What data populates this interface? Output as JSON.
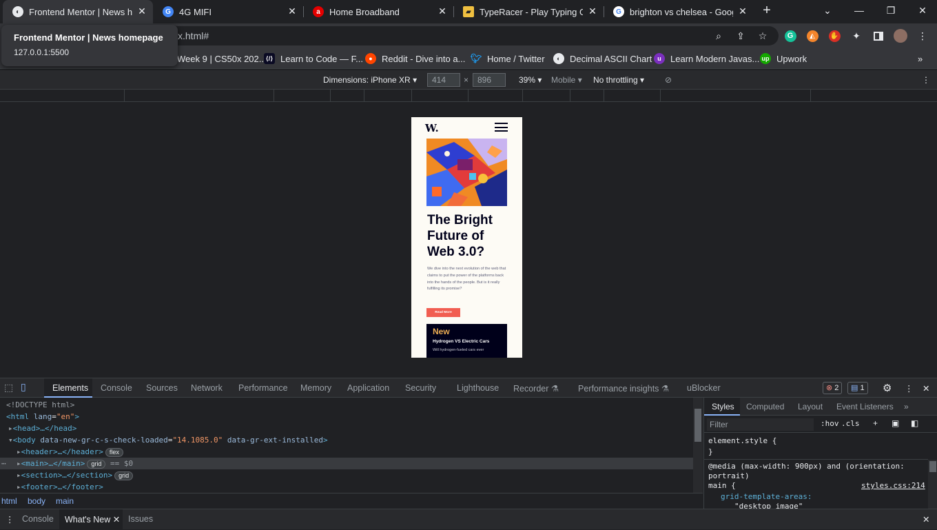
{
  "tabs": [
    {
      "title": "Frontend Mentor | News hom",
      "active": true
    },
    {
      "title": "4G MIFI"
    },
    {
      "title": "Home Broadband"
    },
    {
      "title": "TypeRacer - Play Typing Gam"
    },
    {
      "title": "brighton vs chelsea - Google"
    }
  ],
  "tooltip": {
    "title": "Frontend Mentor | News homepage",
    "url": "127.0.0.1:5500"
  },
  "omnibox": {
    "url": "x.html#"
  },
  "bookmarks": [
    {
      "label": "Week 9 | CS50x 202..."
    },
    {
      "label": "Learn to Code — F..."
    },
    {
      "label": "Reddit - Dive into a..."
    },
    {
      "label": "Home / Twitter"
    },
    {
      "label": "Decimal ASCII Chart"
    },
    {
      "label": "Learn Modern Javas..."
    },
    {
      "label": "Upwork"
    }
  ],
  "device_bar": {
    "dimensions": "Dimensions: iPhone XR",
    "width": "414",
    "x": "×",
    "height": "896",
    "zoom": "39%",
    "mode": "Mobile",
    "throttle": "No throttling"
  },
  "page": {
    "logo": "W.",
    "headline": "The Bright Future of Web 3.0?",
    "description": "We dive into the next evolution of the web that claims to put the power of the platforms back into the hands of the people. But is it really fulfilling its promise?",
    "read_more": "Read More",
    "new_heading": "New",
    "new_title": "Hydrogen VS Electric Cars",
    "new_desc": "Will hydrogen-fueled cars ever"
  },
  "devtools": {
    "tabs": [
      "Elements",
      "Console",
      "Sources",
      "Network",
      "Performance",
      "Memory",
      "Application",
      "Security",
      "Lighthouse",
      "Recorder",
      "Performance insights",
      "uBlocker"
    ],
    "errors": "2",
    "messages": "1",
    "dom": {
      "doctype": "<!DOCTYPE html>",
      "html_open": "<html",
      "lang_attr": "lang",
      "lang_val": "\"en\"",
      "head": "<head>…</head>",
      "body_open": "<body",
      "body_attr1": "data-new-gr-c-s-check-loaded",
      "body_val1": "\"14.1085.0\"",
      "body_attr2": "data-gr-ext-installed",
      "header": "<header>…</header>",
      "header_pill": "flex",
      "main": "<main>…</main>",
      "main_pill": "grid",
      "main_eq": "== $0",
      "section": "<section>…</section>",
      "section_pill": "grid",
      "footer": "<footer>…</footer>"
    },
    "breadcrumbs": [
      "html",
      "body",
      "main"
    ],
    "styles_tabs": [
      "Styles",
      "Computed",
      "Layout",
      "Event Listeners"
    ],
    "filter_placeholder": "Filter",
    "hov": ":hov",
    "cls": ".cls",
    "styles": {
      "element_style": "element.style {",
      "close": "}",
      "media": "@media (max-width: 900px) and (orientation:",
      "media2": "portrait)",
      "selector": "main {",
      "source": "styles.css:214",
      "prop": "grid-template-areas:",
      "val": "\"desktop  image\""
    },
    "drawer_tabs": [
      "Console",
      "What's New",
      "Issues"
    ]
  }
}
